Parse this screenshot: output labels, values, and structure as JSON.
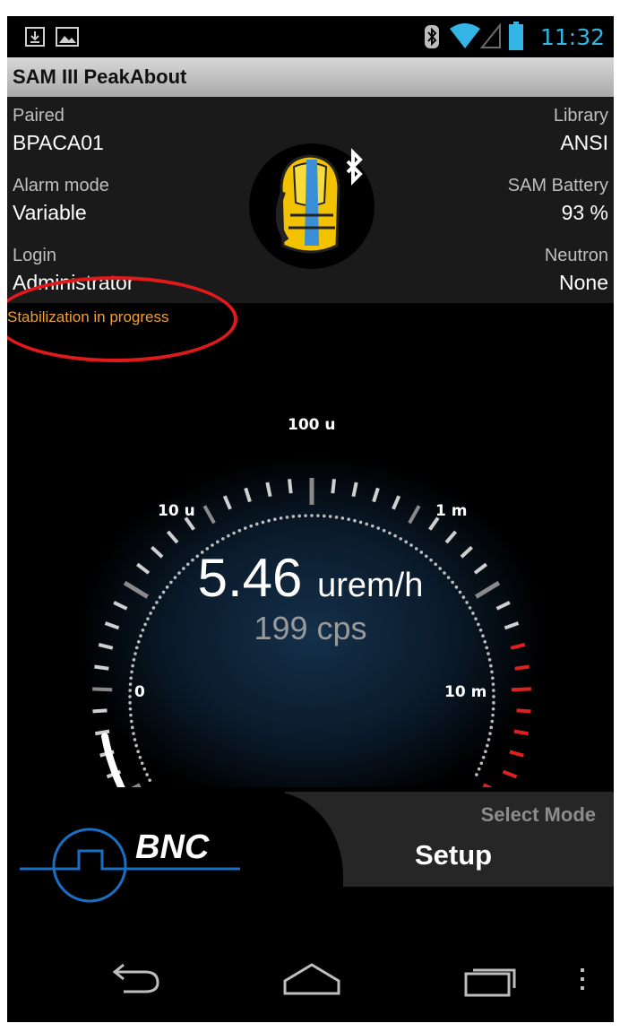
{
  "status_bar": {
    "time": "11:32",
    "battery_color": "#33b5e5"
  },
  "app": {
    "title": "SAM III PeakAbout"
  },
  "info": {
    "paired_label": "Paired",
    "paired_value": "BPACA01",
    "library_label": "Library",
    "library_value": "ANSI",
    "alarm_label": "Alarm mode",
    "alarm_value": "Variable",
    "battery_label": "SAM Battery",
    "battery_value": "93 %",
    "login_label": "Login",
    "login_value": "Administrator",
    "neutron_label": "Neutron",
    "neutron_value": "None"
  },
  "status_message": "Stabilization in progress",
  "gauge": {
    "value": "5.46",
    "unit": "urem/h",
    "cps": "199 cps",
    "scale_labels": [
      "0",
      "10 u",
      "100 u",
      "1 m",
      "10 m"
    ],
    "needle_fraction": 0.07
  },
  "mode": {
    "select_label": "Select Mode",
    "current": "Setup"
  },
  "logo": {
    "text": "BNC"
  },
  "nav": {
    "icons": [
      "back-icon",
      "home-icon",
      "recents-icon",
      "menu-icon"
    ]
  }
}
